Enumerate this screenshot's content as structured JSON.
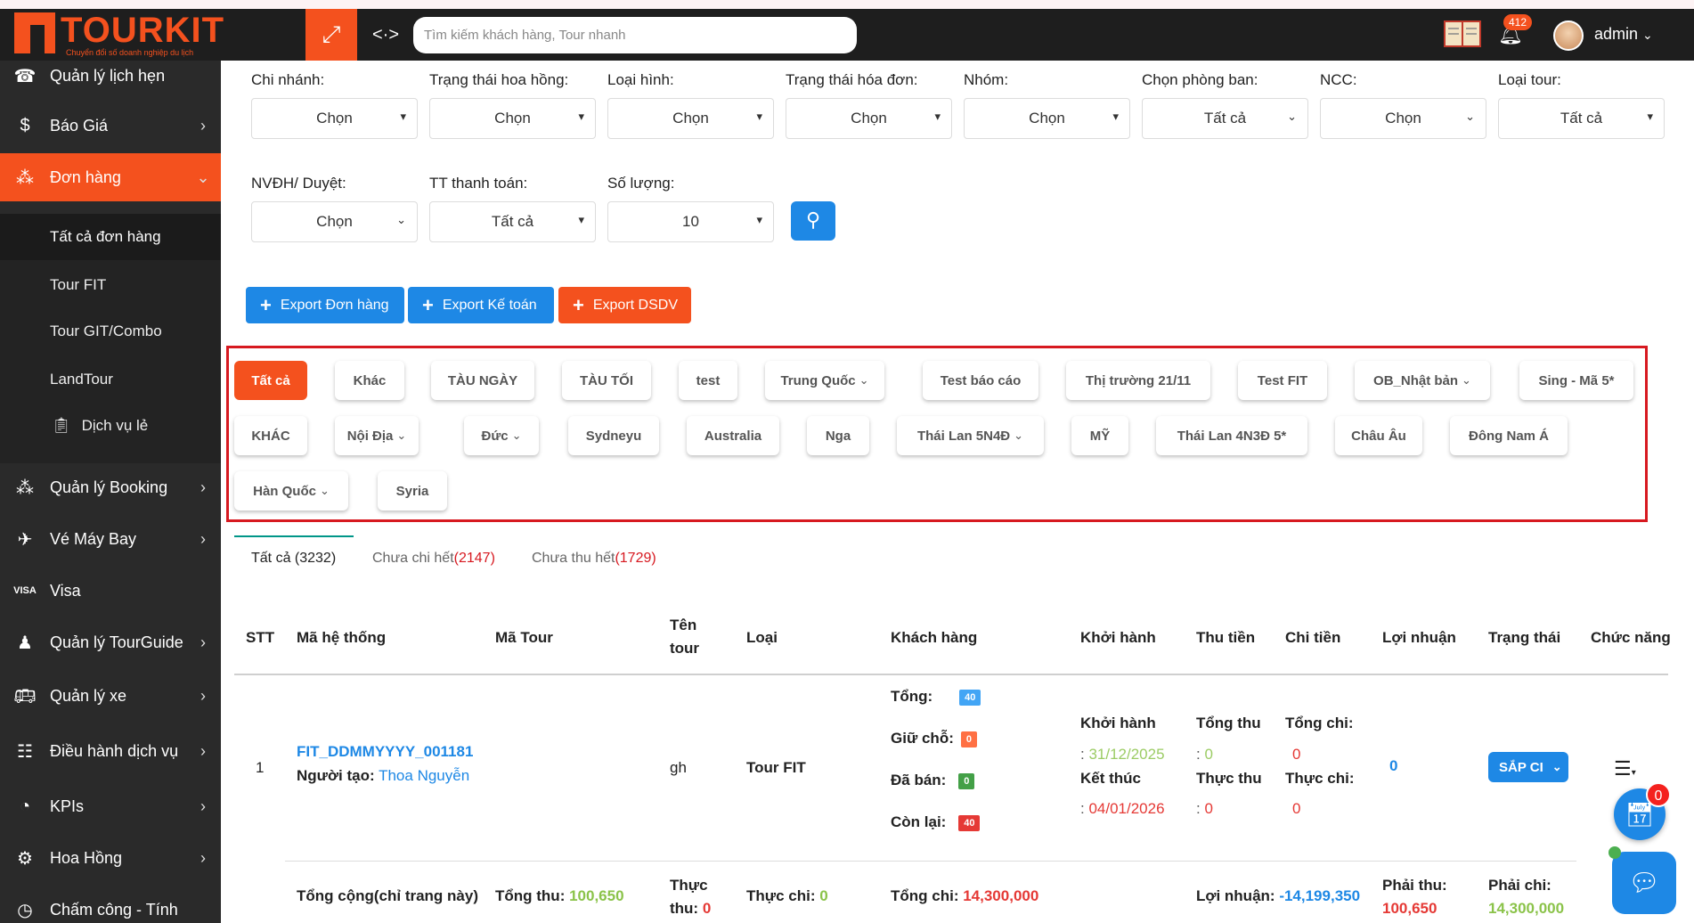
{
  "topbar": {
    "logo_text": "TOURKIT",
    "logo_tagline": "Chuyển đổi số doanh nghiệp du lịch",
    "search_placeholder": "Tìm kiếm khách hàng, Tour nhanh",
    "notification_count": "412",
    "user_name": "admin"
  },
  "sidebar": {
    "items": [
      {
        "label": "Quản lý lịch hẹn",
        "icon": "cskh-icon"
      },
      {
        "label": "Báo Giá",
        "icon": "dollar-file-icon"
      },
      {
        "label": "Đơn hàng",
        "icon": "network-icon"
      },
      {
        "label": "Quản lý Booking",
        "icon": "network-icon"
      },
      {
        "label": "Vé Máy Bay",
        "icon": "plane-icon"
      },
      {
        "label": "Visa",
        "icon": "visa-icon"
      },
      {
        "label": "Quản lý TourGuide",
        "icon": "guide-icon"
      },
      {
        "label": "Quản lý xe",
        "icon": "bus-icon"
      },
      {
        "label": "Điều hành dịch vụ",
        "icon": "team-icon"
      },
      {
        "label": "KPIs",
        "icon": "gauge-icon"
      },
      {
        "label": "Hoa Hồng",
        "icon": "gear-icon"
      },
      {
        "label": "Chấm công - Tính",
        "icon": "clock-icon"
      }
    ],
    "submenu": [
      {
        "label": "Tất cả đơn hàng"
      },
      {
        "label": "Tour FIT"
      },
      {
        "label": "Tour GIT/Combo"
      },
      {
        "label": "LandTour"
      },
      {
        "label": "Dịch vụ lẻ"
      }
    ]
  },
  "filters": [
    {
      "label": "Chi nhánh:",
      "value": "Chọn"
    },
    {
      "label": "Trạng thái hoa hồng:",
      "value": "Chọn"
    },
    {
      "label": "Loại hình:",
      "value": "Chọn"
    },
    {
      "label": "Trạng thái hóa đơn:",
      "value": "Chọn"
    },
    {
      "label": "Nhóm:",
      "value": "Chọn"
    },
    {
      "label": "Chọn phòng ban:",
      "value": "Tất cả"
    },
    {
      "label": "NCC:",
      "value": "Chọn"
    },
    {
      "label": "Loại tour:",
      "value": "Tất cả"
    },
    {
      "label": "NVĐH/ Duyệt:",
      "value": "Chọn"
    },
    {
      "label": "TT thanh toán:",
      "value": "Tất cả"
    },
    {
      "label": "Số lượng:",
      "value": "10"
    }
  ],
  "export_buttons": [
    {
      "label": "Export Đơn hàng",
      "color": "#1e88e5"
    },
    {
      "label": "Export Kế toán",
      "color": "#1e88e5"
    },
    {
      "label": "Export DSDV",
      "color": "#f4511e"
    }
  ],
  "tags": [
    {
      "label": "Tất cả"
    },
    {
      "label": "Khác"
    },
    {
      "label": "TÀU NGÀY"
    },
    {
      "label": "TÀU TỐI"
    },
    {
      "label": "test"
    },
    {
      "label": "Trung Quốc"
    },
    {
      "label": "Test báo cáo"
    },
    {
      "label": "Thị trường 21/11"
    },
    {
      "label": "Test FIT"
    },
    {
      "label": "OB_Nhật bản"
    },
    {
      "label": "Sing - Mã 5*"
    },
    {
      "label": "KHÁC"
    },
    {
      "label": "Nội Địa"
    },
    {
      "label": "Đức"
    },
    {
      "label": "Sydneyu"
    },
    {
      "label": "Australia"
    },
    {
      "label": "Nga"
    },
    {
      "label": "Thái Lan 5N4Đ"
    },
    {
      "label": "MỸ"
    },
    {
      "label": "Thái Lan 4N3Đ 5*"
    },
    {
      "label": "Châu Âu"
    },
    {
      "label": "Đông Nam Á"
    },
    {
      "label": "Hàn Quốc"
    },
    {
      "label": "Syria"
    }
  ],
  "tabs": [
    {
      "label": "Tất cả (3232)"
    },
    {
      "label": "Chưa chi hết",
      "count": "(2147)"
    },
    {
      "label": "Chưa thu hết",
      "count": "(1729)"
    }
  ],
  "table": {
    "headers": {
      "stt": "STT",
      "ma_he_thong": "Mã hệ thống",
      "ma_tour": "Mã Tour",
      "ten_tour_1": "Tên",
      "ten_tour_2": "tour",
      "loai": "Loại",
      "khach_hang": "Khách hàng",
      "khoi_hanh": "Khởi hành",
      "thu_tien": "Thu tiền",
      "chi_tien": "Chi tiền",
      "loi_nhuan": "Lợi nhuận",
      "trang_thai": "Trạng thái",
      "chuc_nang": "Chức năng"
    },
    "row": {
      "stt": "1",
      "code": "FIT_DDMMYYYY_001181",
      "creator_label": "Người tạo:",
      "creator": "Thoa Nguyễn",
      "ten_tour": "gh",
      "loai": "Tour FIT",
      "tong_label": "Tổng:",
      "tong": "40",
      "giu_cho_label": "Giữ chỗ:",
      "giu_cho": "0",
      "da_ban_label": "Đã bán:",
      "da_ban": "0",
      "con_lai_label": "Còn lại:",
      "con_lai": "40",
      "khoi_hanh_label": "Khởi hành",
      "khoi_hanh_date": "31/12/2025",
      "ket_thuc_label": "Kết thúc",
      "ket_thuc_date": "04/01/2026",
      "tong_thu_label": "Tổng thu",
      "tong_thu": "0",
      "thuc_thu_label": "Thực thu",
      "thuc_thu": "0",
      "tong_chi_label": "Tổng chi:",
      "tong_chi": "0",
      "thuc_chi_label": "Thực chi:",
      "thuc_chi": "0",
      "loi_nhuan": "0",
      "status": "SẮP CI"
    },
    "footer": {
      "label": "Tổng cộng(chỉ trang này)",
      "tong_thu_label": "Tổng thu:",
      "tong_thu": "100,650",
      "thuc_thu_label_1": "Thực",
      "thuc_thu_label_2": "thu:",
      "thuc_thu": "0",
      "thuc_chi_label": "Thực chi:",
      "thuc_chi": "0",
      "tong_chi_label": "Tổng chi:",
      "tong_chi": "14,300,000",
      "loi_nhuan_label": "Lợi nhuận:",
      "loi_nhuan": "-14,199,350",
      "phai_thu_label": "Phải thu:",
      "phai_thu": "100,650",
      "phai_chi_label": "Phải chi:",
      "phai_chi": "14,300,000"
    }
  },
  "floating": {
    "calendar_badge": "0"
  }
}
